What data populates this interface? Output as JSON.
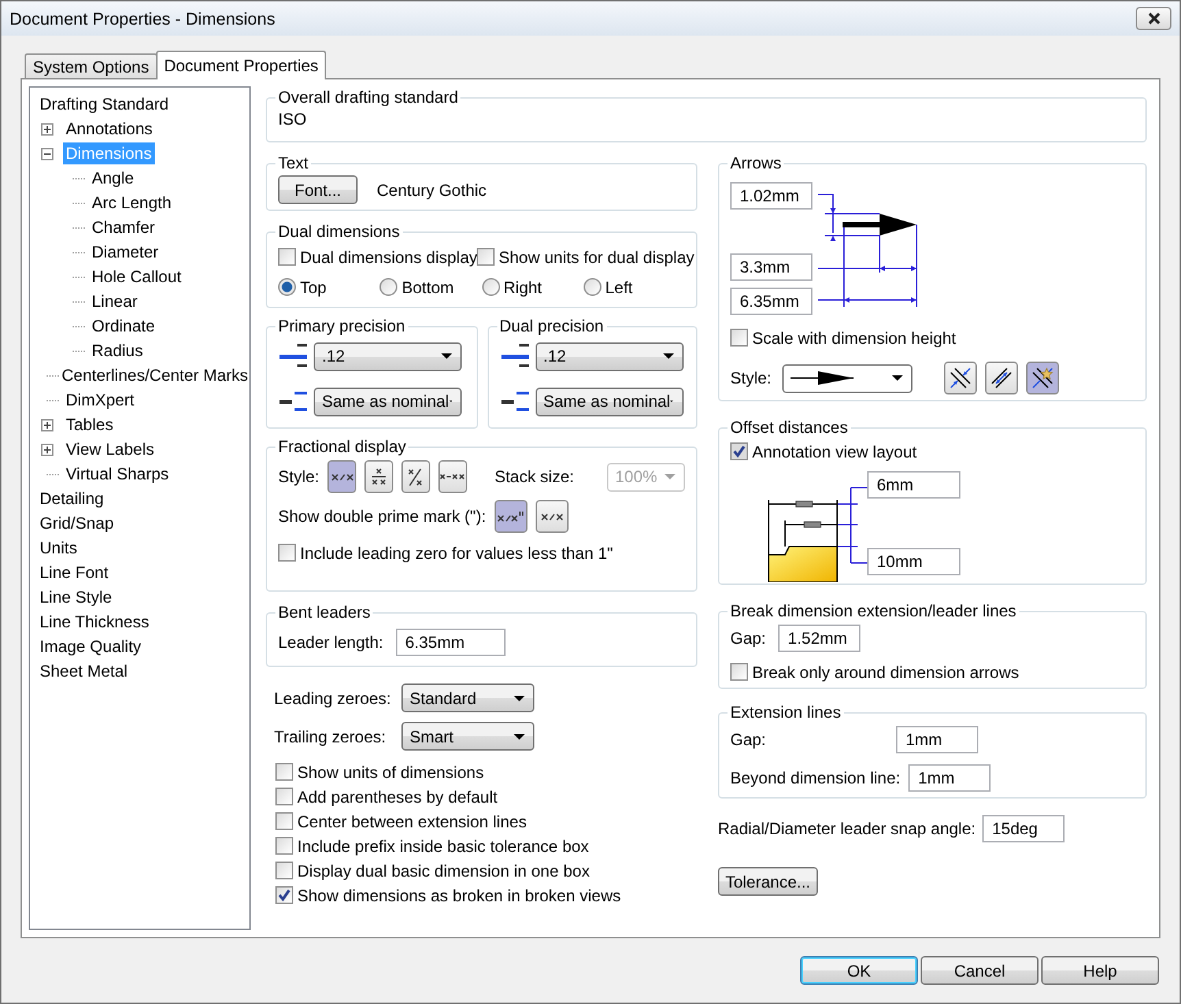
{
  "window": {
    "title": "Document Properties - Dimensions"
  },
  "tabs": [
    {
      "label": "System Options",
      "selected": false
    },
    {
      "label": "Document Properties",
      "selected": true
    }
  ],
  "tree": [
    {
      "label": "Drafting Standard",
      "selected": false,
      "children": [
        {
          "label": "Annotations",
          "selected": false,
          "expanded": false
        },
        {
          "label": "Dimensions",
          "selected": true,
          "expanded": true,
          "children": [
            {
              "label": "Angle",
              "selected": false
            },
            {
              "label": "Arc Length",
              "selected": false
            },
            {
              "label": "Chamfer",
              "selected": false
            },
            {
              "label": "Diameter",
              "selected": false
            },
            {
              "label": "Hole Callout",
              "selected": false
            },
            {
              "label": "Linear",
              "selected": false
            },
            {
              "label": "Ordinate",
              "selected": false
            },
            {
              "label": "Radius",
              "selected": false
            }
          ]
        },
        {
          "label": "Centerlines/Center Marks",
          "selected": false
        },
        {
          "label": "DimXpert",
          "selected": false
        },
        {
          "label": "Tables",
          "selected": false,
          "expanded": false
        },
        {
          "label": "View Labels",
          "selected": false,
          "expanded": false
        },
        {
          "label": "Virtual Sharps",
          "selected": false
        }
      ]
    },
    {
      "label": "Detailing",
      "selected": false
    },
    {
      "label": "Grid/Snap",
      "selected": false
    },
    {
      "label": "Units",
      "selected": false
    },
    {
      "label": "Line Font",
      "selected": false
    },
    {
      "label": "Line Style",
      "selected": false
    },
    {
      "label": "Line Thickness",
      "selected": false
    },
    {
      "label": "Image Quality",
      "selected": false
    },
    {
      "label": "Sheet Metal",
      "selected": false
    }
  ],
  "overall": {
    "title": "Overall drafting standard",
    "value": "ISO"
  },
  "text": {
    "title": "Text",
    "button": "Font...",
    "font": "Century Gothic"
  },
  "dual_dimensions": {
    "title": "Dual dimensions",
    "checkboxes": [
      {
        "label": "Dual dimensions display",
        "checked": false
      },
      {
        "label": "Show units for dual display",
        "checked": false
      }
    ],
    "positions": [
      {
        "label": "Top",
        "selected": true
      },
      {
        "label": "Bottom",
        "selected": false
      },
      {
        "label": "Right",
        "selected": false
      },
      {
        "label": "Left",
        "selected": false
      }
    ]
  },
  "precision": [
    {
      "title": "Primary precision",
      "value": ".12",
      "tolerance": "Same as nominal"
    },
    {
      "title": "Dual precision",
      "value": ".12",
      "tolerance": "Same as nominal"
    }
  ],
  "fractional": {
    "title": "Fractional display",
    "style_label": "Style:",
    "styles": [
      {
        "kind": "diagonal",
        "selected": true
      },
      {
        "kind": "stacked",
        "selected": false
      },
      {
        "kind": "small",
        "selected": false
      },
      {
        "kind": "hyphen",
        "selected": false
      }
    ],
    "stack_label": "Stack size:",
    "stack_value": "100%",
    "stack_disabled": true,
    "prime_label": "Show double prime mark (\"):",
    "prime_styles": [
      {
        "kind": "prime",
        "selected": true
      },
      {
        "kind": "diagonal",
        "selected": false
      }
    ],
    "leading_zero": {
      "label": "Include leading zero for values less than 1\"",
      "checked": false
    }
  },
  "bent_leaders": {
    "title": "Bent leaders",
    "label": "Leader length:",
    "value": "6.35mm"
  },
  "zeroes": [
    {
      "label": "Leading zeroes:",
      "value": "Standard"
    },
    {
      "label": "Trailing zeroes:",
      "value": "Smart"
    }
  ],
  "options": [
    {
      "label": "Show units of dimensions",
      "checked": false
    },
    {
      "label": "Add parentheses by default",
      "checked": false
    },
    {
      "label": "Center between extension lines",
      "checked": false
    },
    {
      "label": "Include prefix inside basic tolerance box",
      "checked": false
    },
    {
      "label": "Display dual basic dimension in one box",
      "checked": false
    },
    {
      "label": "Show dimensions as broken in broken views",
      "checked": true
    }
  ],
  "arrows": {
    "title": "Arrows",
    "height": "1.02mm",
    "width": "3.3mm",
    "length": "6.35mm",
    "scale": {
      "label": "Scale with dimension height",
      "checked": false
    },
    "style_label": "Style:",
    "placements": [
      {
        "kind": "inside",
        "selected": false
      },
      {
        "kind": "outside",
        "selected": false
      },
      {
        "kind": "smart",
        "selected": true
      }
    ]
  },
  "offset": {
    "title": "Offset distances",
    "annotation": {
      "label": "Annotation view layout",
      "checked": true
    },
    "values": [
      "6mm",
      "10mm"
    ]
  },
  "break_lines": {
    "title": "Break dimension extension/leader lines",
    "gap_label": "Gap:",
    "gap": "1.52mm",
    "arrows_only": {
      "label": "Break only around dimension arrows",
      "checked": false
    }
  },
  "extension": {
    "title": "Extension lines",
    "rows": [
      {
        "label": "Gap:",
        "value": "1mm"
      },
      {
        "label": "Beyond dimension line:",
        "value": "1mm"
      }
    ]
  },
  "snap": {
    "label": "Radial/Diameter leader snap angle:",
    "value": "15deg"
  },
  "tolerance_button": "Tolerance...",
  "footer": [
    {
      "label": "OK",
      "default": true
    },
    {
      "label": "Cancel",
      "default": false
    },
    {
      "label": "Help",
      "default": false
    }
  ]
}
